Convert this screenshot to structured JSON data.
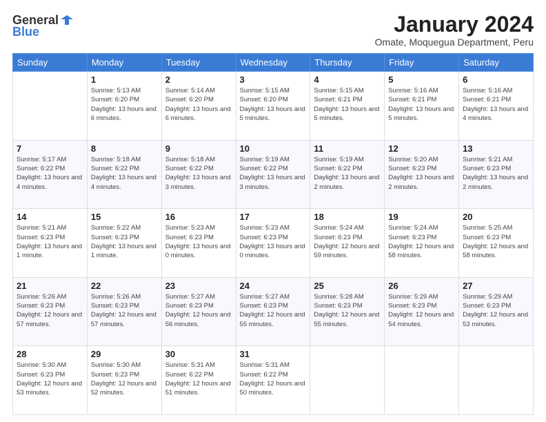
{
  "logo": {
    "general": "General",
    "blue": "Blue"
  },
  "header": {
    "title": "January 2024",
    "subtitle": "Omate, Moquegua Department, Peru"
  },
  "weekdays": [
    "Sunday",
    "Monday",
    "Tuesday",
    "Wednesday",
    "Thursday",
    "Friday",
    "Saturday"
  ],
  "weeks": [
    [
      {
        "day": "",
        "sunrise": "",
        "sunset": "",
        "daylight": ""
      },
      {
        "day": "1",
        "sunrise": "Sunrise: 5:13 AM",
        "sunset": "Sunset: 6:20 PM",
        "daylight": "Daylight: 13 hours and 6 minutes."
      },
      {
        "day": "2",
        "sunrise": "Sunrise: 5:14 AM",
        "sunset": "Sunset: 6:20 PM",
        "daylight": "Daylight: 13 hours and 6 minutes."
      },
      {
        "day": "3",
        "sunrise": "Sunrise: 5:15 AM",
        "sunset": "Sunset: 6:20 PM",
        "daylight": "Daylight: 13 hours and 5 minutes."
      },
      {
        "day": "4",
        "sunrise": "Sunrise: 5:15 AM",
        "sunset": "Sunset: 6:21 PM",
        "daylight": "Daylight: 13 hours and 5 minutes."
      },
      {
        "day": "5",
        "sunrise": "Sunrise: 5:16 AM",
        "sunset": "Sunset: 6:21 PM",
        "daylight": "Daylight: 13 hours and 5 minutes."
      },
      {
        "day": "6",
        "sunrise": "Sunrise: 5:16 AM",
        "sunset": "Sunset: 6:21 PM",
        "daylight": "Daylight: 13 hours and 4 minutes."
      }
    ],
    [
      {
        "day": "7",
        "sunrise": "Sunrise: 5:17 AM",
        "sunset": "Sunset: 6:22 PM",
        "daylight": "Daylight: 13 hours and 4 minutes."
      },
      {
        "day": "8",
        "sunrise": "Sunrise: 5:18 AM",
        "sunset": "Sunset: 6:22 PM",
        "daylight": "Daylight: 13 hours and 4 minutes."
      },
      {
        "day": "9",
        "sunrise": "Sunrise: 5:18 AM",
        "sunset": "Sunset: 6:22 PM",
        "daylight": "Daylight: 13 hours and 3 minutes."
      },
      {
        "day": "10",
        "sunrise": "Sunrise: 5:19 AM",
        "sunset": "Sunset: 6:22 PM",
        "daylight": "Daylight: 13 hours and 3 minutes."
      },
      {
        "day": "11",
        "sunrise": "Sunrise: 5:19 AM",
        "sunset": "Sunset: 6:22 PM",
        "daylight": "Daylight: 13 hours and 2 minutes."
      },
      {
        "day": "12",
        "sunrise": "Sunrise: 5:20 AM",
        "sunset": "Sunset: 6:23 PM",
        "daylight": "Daylight: 13 hours and 2 minutes."
      },
      {
        "day": "13",
        "sunrise": "Sunrise: 5:21 AM",
        "sunset": "Sunset: 6:23 PM",
        "daylight": "Daylight: 13 hours and 2 minutes."
      }
    ],
    [
      {
        "day": "14",
        "sunrise": "Sunrise: 5:21 AM",
        "sunset": "Sunset: 6:23 PM",
        "daylight": "Daylight: 13 hours and 1 minute."
      },
      {
        "day": "15",
        "sunrise": "Sunrise: 5:22 AM",
        "sunset": "Sunset: 6:23 PM",
        "daylight": "Daylight: 13 hours and 1 minute."
      },
      {
        "day": "16",
        "sunrise": "Sunrise: 5:23 AM",
        "sunset": "Sunset: 6:23 PM",
        "daylight": "Daylight: 13 hours and 0 minutes."
      },
      {
        "day": "17",
        "sunrise": "Sunrise: 5:23 AM",
        "sunset": "Sunset: 6:23 PM",
        "daylight": "Daylight: 13 hours and 0 minutes."
      },
      {
        "day": "18",
        "sunrise": "Sunrise: 5:24 AM",
        "sunset": "Sunset: 6:23 PM",
        "daylight": "Daylight: 12 hours and 59 minutes."
      },
      {
        "day": "19",
        "sunrise": "Sunrise: 5:24 AM",
        "sunset": "Sunset: 6:23 PM",
        "daylight": "Daylight: 12 hours and 58 minutes."
      },
      {
        "day": "20",
        "sunrise": "Sunrise: 5:25 AM",
        "sunset": "Sunset: 6:23 PM",
        "daylight": "Daylight: 12 hours and 58 minutes."
      }
    ],
    [
      {
        "day": "21",
        "sunrise": "Sunrise: 5:26 AM",
        "sunset": "Sunset: 6:23 PM",
        "daylight": "Daylight: 12 hours and 57 minutes."
      },
      {
        "day": "22",
        "sunrise": "Sunrise: 5:26 AM",
        "sunset": "Sunset: 6:23 PM",
        "daylight": "Daylight: 12 hours and 57 minutes."
      },
      {
        "day": "23",
        "sunrise": "Sunrise: 5:27 AM",
        "sunset": "Sunset: 6:23 PM",
        "daylight": "Daylight: 12 hours and 56 minutes."
      },
      {
        "day": "24",
        "sunrise": "Sunrise: 5:27 AM",
        "sunset": "Sunset: 6:23 PM",
        "daylight": "Daylight: 12 hours and 55 minutes."
      },
      {
        "day": "25",
        "sunrise": "Sunrise: 5:28 AM",
        "sunset": "Sunset: 6:23 PM",
        "daylight": "Daylight: 12 hours and 55 minutes."
      },
      {
        "day": "26",
        "sunrise": "Sunrise: 5:29 AM",
        "sunset": "Sunset: 6:23 PM",
        "daylight": "Daylight: 12 hours and 54 minutes."
      },
      {
        "day": "27",
        "sunrise": "Sunrise: 5:29 AM",
        "sunset": "Sunset: 6:23 PM",
        "daylight": "Daylight: 12 hours and 53 minutes."
      }
    ],
    [
      {
        "day": "28",
        "sunrise": "Sunrise: 5:30 AM",
        "sunset": "Sunset: 6:23 PM",
        "daylight": "Daylight: 12 hours and 53 minutes."
      },
      {
        "day": "29",
        "sunrise": "Sunrise: 5:30 AM",
        "sunset": "Sunset: 6:23 PM",
        "daylight": "Daylight: 12 hours and 52 minutes."
      },
      {
        "day": "30",
        "sunrise": "Sunrise: 5:31 AM",
        "sunset": "Sunset: 6:22 PM",
        "daylight": "Daylight: 12 hours and 51 minutes."
      },
      {
        "day": "31",
        "sunrise": "Sunrise: 5:31 AM",
        "sunset": "Sunset: 6:22 PM",
        "daylight": "Daylight: 12 hours and 50 minutes."
      },
      {
        "day": "",
        "sunrise": "",
        "sunset": "",
        "daylight": ""
      },
      {
        "day": "",
        "sunrise": "",
        "sunset": "",
        "daylight": ""
      },
      {
        "day": "",
        "sunrise": "",
        "sunset": "",
        "daylight": ""
      }
    ]
  ]
}
